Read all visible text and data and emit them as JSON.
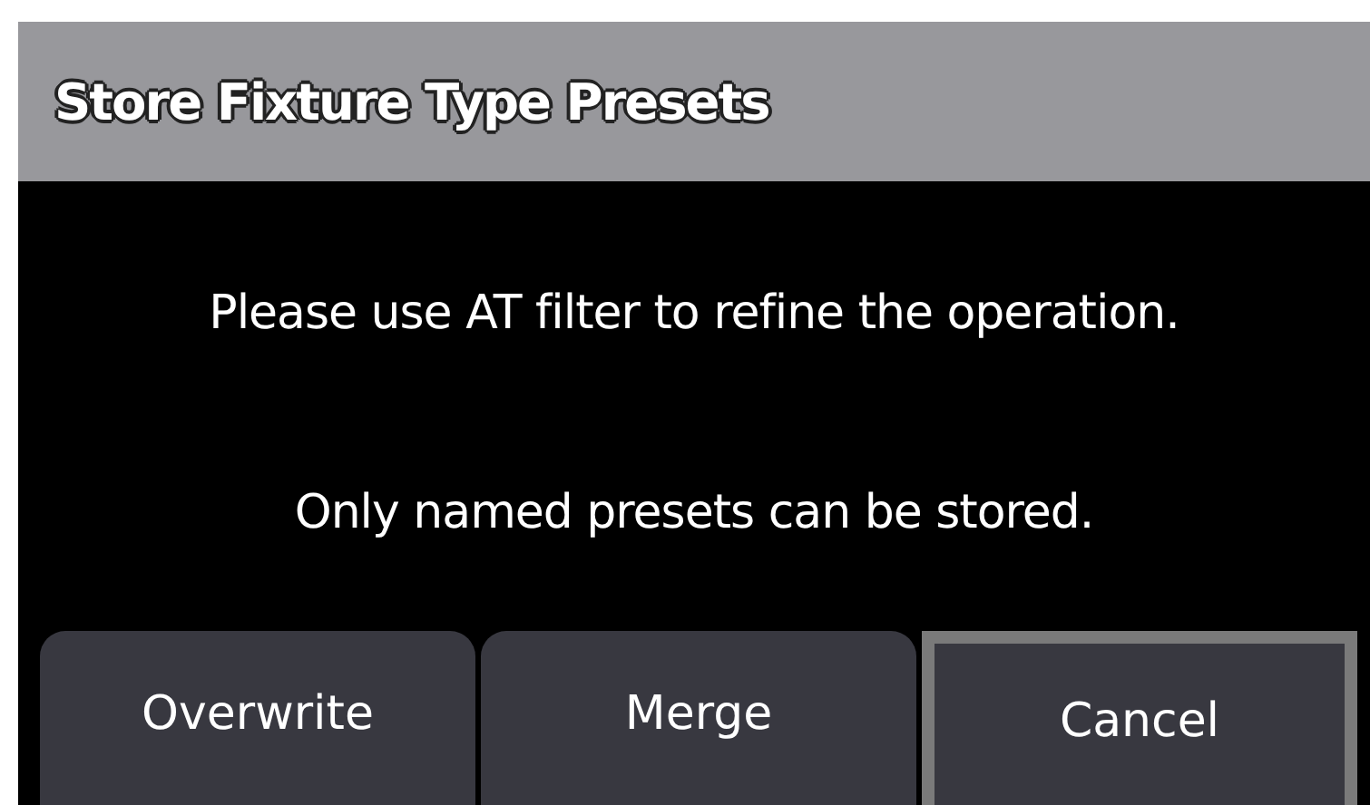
{
  "dialog": {
    "title": "Store Fixture Type Presets",
    "messages": [
      "Please use AT filter to refine the operation.",
      "Only named presets can be stored."
    ],
    "buttons": [
      {
        "label": "Overwrite",
        "selected": false
      },
      {
        "label": "Merge",
        "selected": false
      },
      {
        "label": "Cancel",
        "selected": true
      }
    ]
  }
}
